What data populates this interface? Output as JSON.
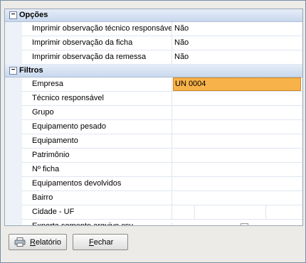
{
  "sections": [
    {
      "title": "Opções",
      "items": [
        {
          "label": "Imprimir observação técnico responsável",
          "value": "Não"
        },
        {
          "label": "Imprimir observação da ficha",
          "value": "Não"
        },
        {
          "label": "Imprimir observação da remessa",
          "value": "Não"
        }
      ]
    },
    {
      "title": "Filtros",
      "items": [
        {
          "label": "Empresa",
          "value": "UN 0004"
        },
        {
          "label": "Técnico responsável",
          "value": ""
        },
        {
          "label": "Grupo",
          "value": ""
        },
        {
          "label": "Equipamento pesado",
          "value": ""
        },
        {
          "label": "Equipamento",
          "value": ""
        },
        {
          "label": "Patrimônio",
          "value": ""
        },
        {
          "label": "Nº ficha",
          "value": ""
        },
        {
          "label": "Equipamentos devolvidos",
          "value": ""
        },
        {
          "label": "Bairro",
          "value": ""
        },
        {
          "label": "Cidade - UF",
          "value": ""
        },
        {
          "label": "Exporta somente arquivo csv",
          "value": ""
        }
      ]
    }
  ],
  "toggle_symbol": "−",
  "buttons": {
    "report": {
      "mnemonic": "R",
      "rest": "elatório",
      "icon": "printer-icon"
    },
    "close": {
      "mnemonic": "F",
      "rest": "echar"
    }
  },
  "colors": {
    "selected_bg": "#f7b24a",
    "category_bg": "#d3e0f2"
  }
}
